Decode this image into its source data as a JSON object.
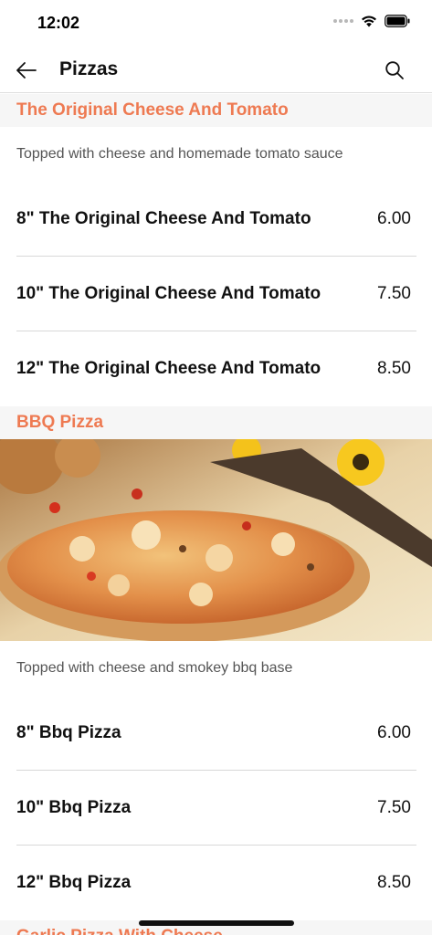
{
  "status_bar": {
    "time": "12:02"
  },
  "header": {
    "title": "Pizzas"
  },
  "sections": [
    {
      "title": "The Original Cheese And Tomato",
      "description": "Topped with cheese and homemade tomato sauce",
      "items": [
        {
          "name": "8\" The Original Cheese And Tomato",
          "price": "6.00"
        },
        {
          "name": "10\" The Original Cheese And Tomato",
          "price": "7.50"
        },
        {
          "name": "12\" The Original Cheese And Tomato",
          "price": "8.50"
        }
      ]
    },
    {
      "title": "BBQ Pizza",
      "description": "Topped with cheese and smokey bbq base",
      "items": [
        {
          "name": "8\" Bbq Pizza",
          "price": "6.00"
        },
        {
          "name": "10\" Bbq Pizza",
          "price": "7.50"
        },
        {
          "name": "12\" Bbq Pizza",
          "price": "8.50"
        }
      ]
    },
    {
      "title": "Garlic Pizza With Cheese"
    }
  ],
  "colors": {
    "accent": "#ee7a52",
    "section_bg": "#f6f6f6",
    "divider": "#d8d8d8"
  }
}
